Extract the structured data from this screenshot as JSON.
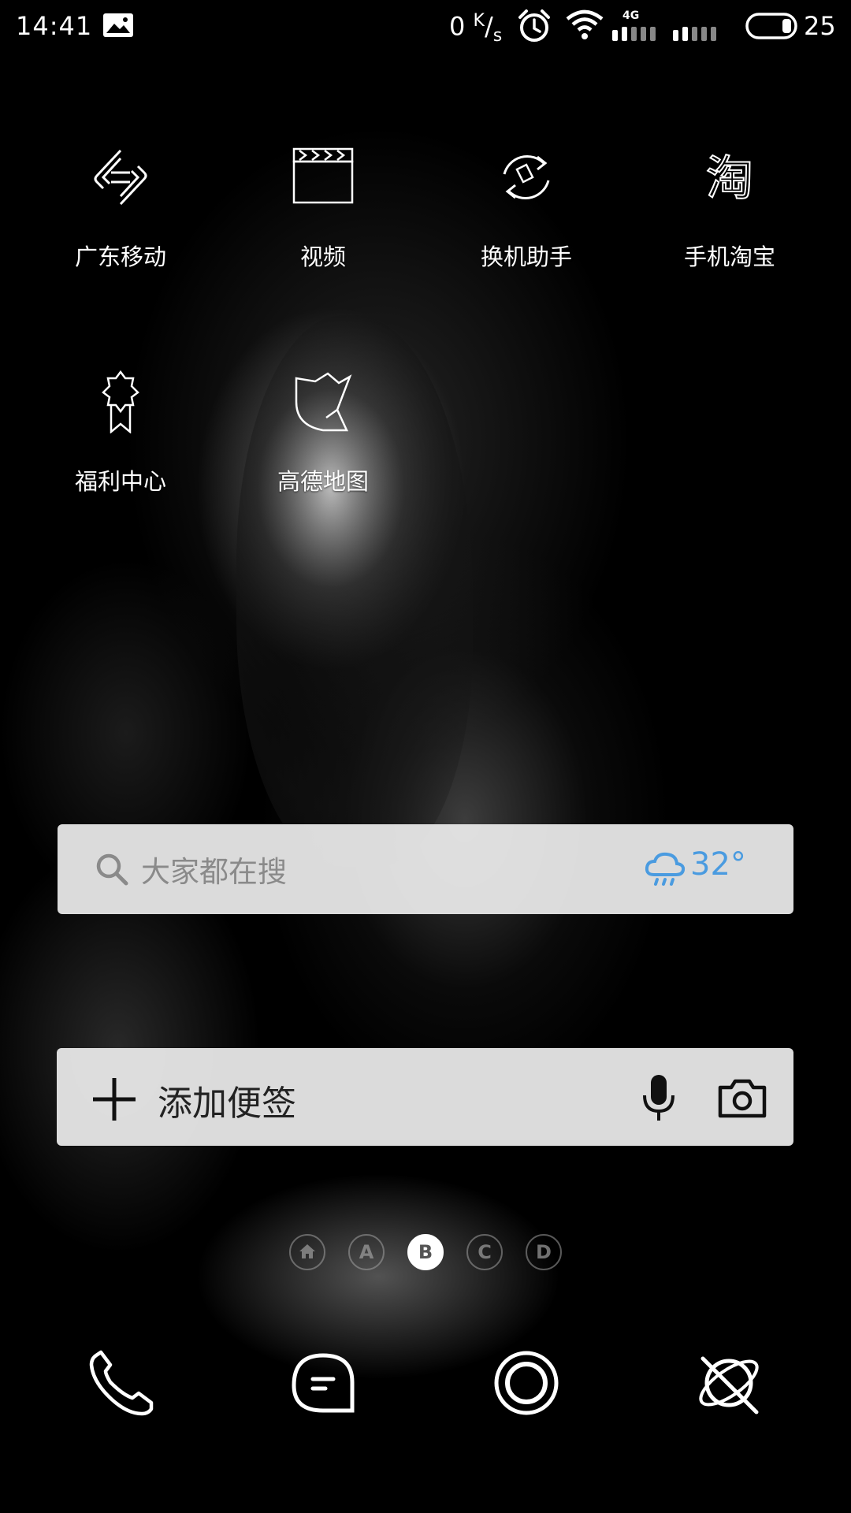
{
  "status_bar": {
    "time": "14:41",
    "net_speed_value": "0",
    "net_speed_unit_top": "K",
    "net_speed_unit_bottom": "s",
    "network_type": "4G",
    "battery_level": "25"
  },
  "apps": [
    {
      "label": "广东移动",
      "icon": "china-mobile-icon"
    },
    {
      "label": "视频",
      "icon": "video-clapper-icon"
    },
    {
      "label": "换机助手",
      "icon": "phone-switch-icon"
    },
    {
      "label": "手机淘宝",
      "icon": "taobao-icon"
    },
    {
      "label": "福利中心",
      "icon": "ribbon-badge-icon"
    },
    {
      "label": "高德地图",
      "icon": "amap-icon"
    }
  ],
  "search_widget": {
    "placeholder": "大家都在搜",
    "temperature": "32°",
    "weather_icon": "cloud-rain-icon",
    "accent_color": "#4a9be0"
  },
  "note_widget": {
    "label": "添加便签"
  },
  "pages": [
    "home",
    "A",
    "B",
    "C",
    "D"
  ],
  "active_page": "B",
  "dock": [
    "phone-icon",
    "messages-icon",
    "camera-app-icon",
    "browser-icon"
  ]
}
